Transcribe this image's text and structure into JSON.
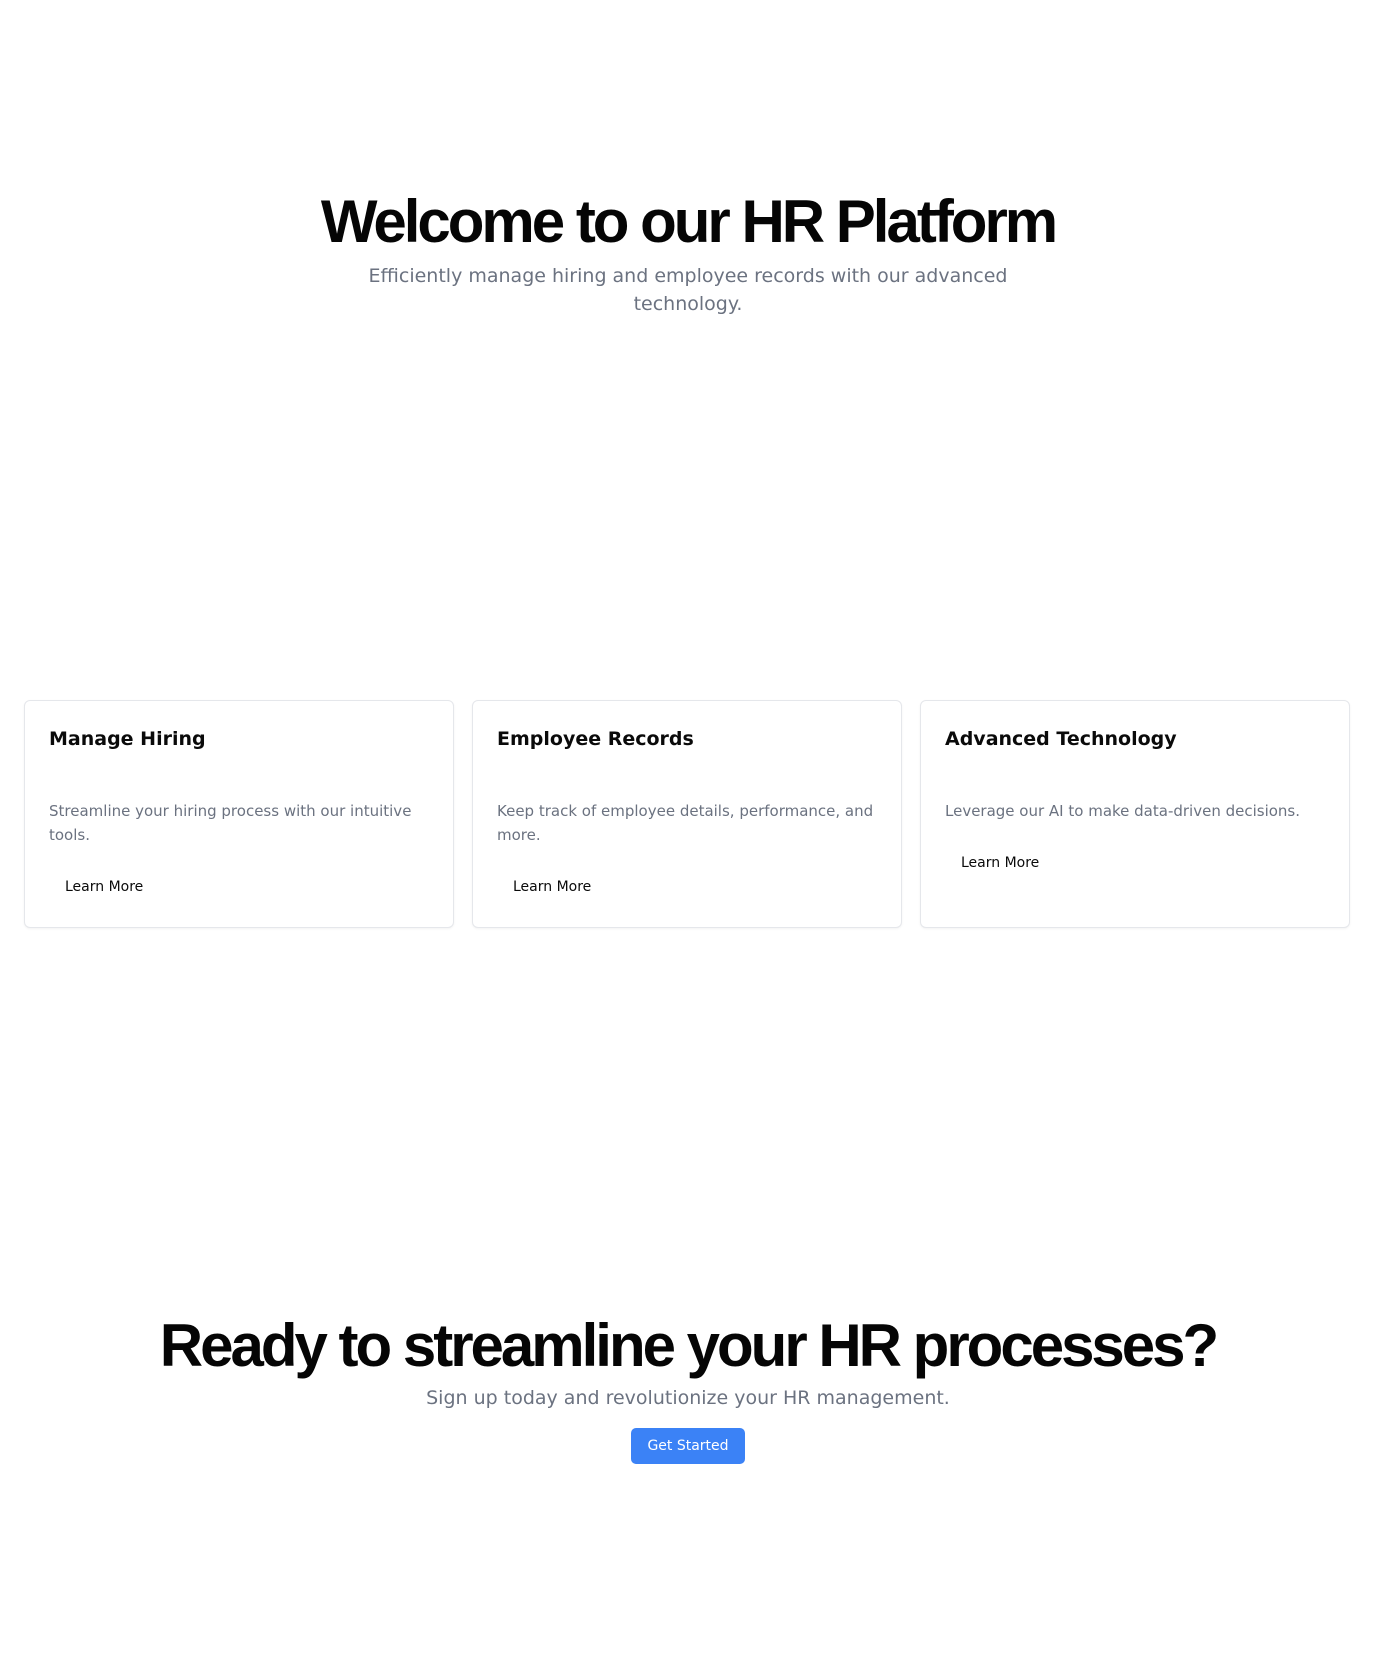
{
  "hero": {
    "title": "Welcome to our HR Platform",
    "subtitle": "Efficiently manage hiring and employee records with our advanced technology."
  },
  "features": [
    {
      "title": "Manage Hiring",
      "description": "Streamline your hiring process with our intuitive tools.",
      "button": "Learn More"
    },
    {
      "title": "Employee Records",
      "description": "Keep track of employee details, performance, and more.",
      "button": "Learn More"
    },
    {
      "title": "Advanced Technology",
      "description": "Leverage our AI to make data-driven decisions.",
      "button": "Learn More"
    }
  ],
  "cta": {
    "title": "Ready to streamline your HR processes?",
    "subtitle": "Sign up today and revolutionize your HR management.",
    "button": "Get Started"
  },
  "colors": {
    "text": "#0a0a0a",
    "muted": "#6b7280",
    "border": "#e5e7eb",
    "accent": "#3b82f6"
  }
}
